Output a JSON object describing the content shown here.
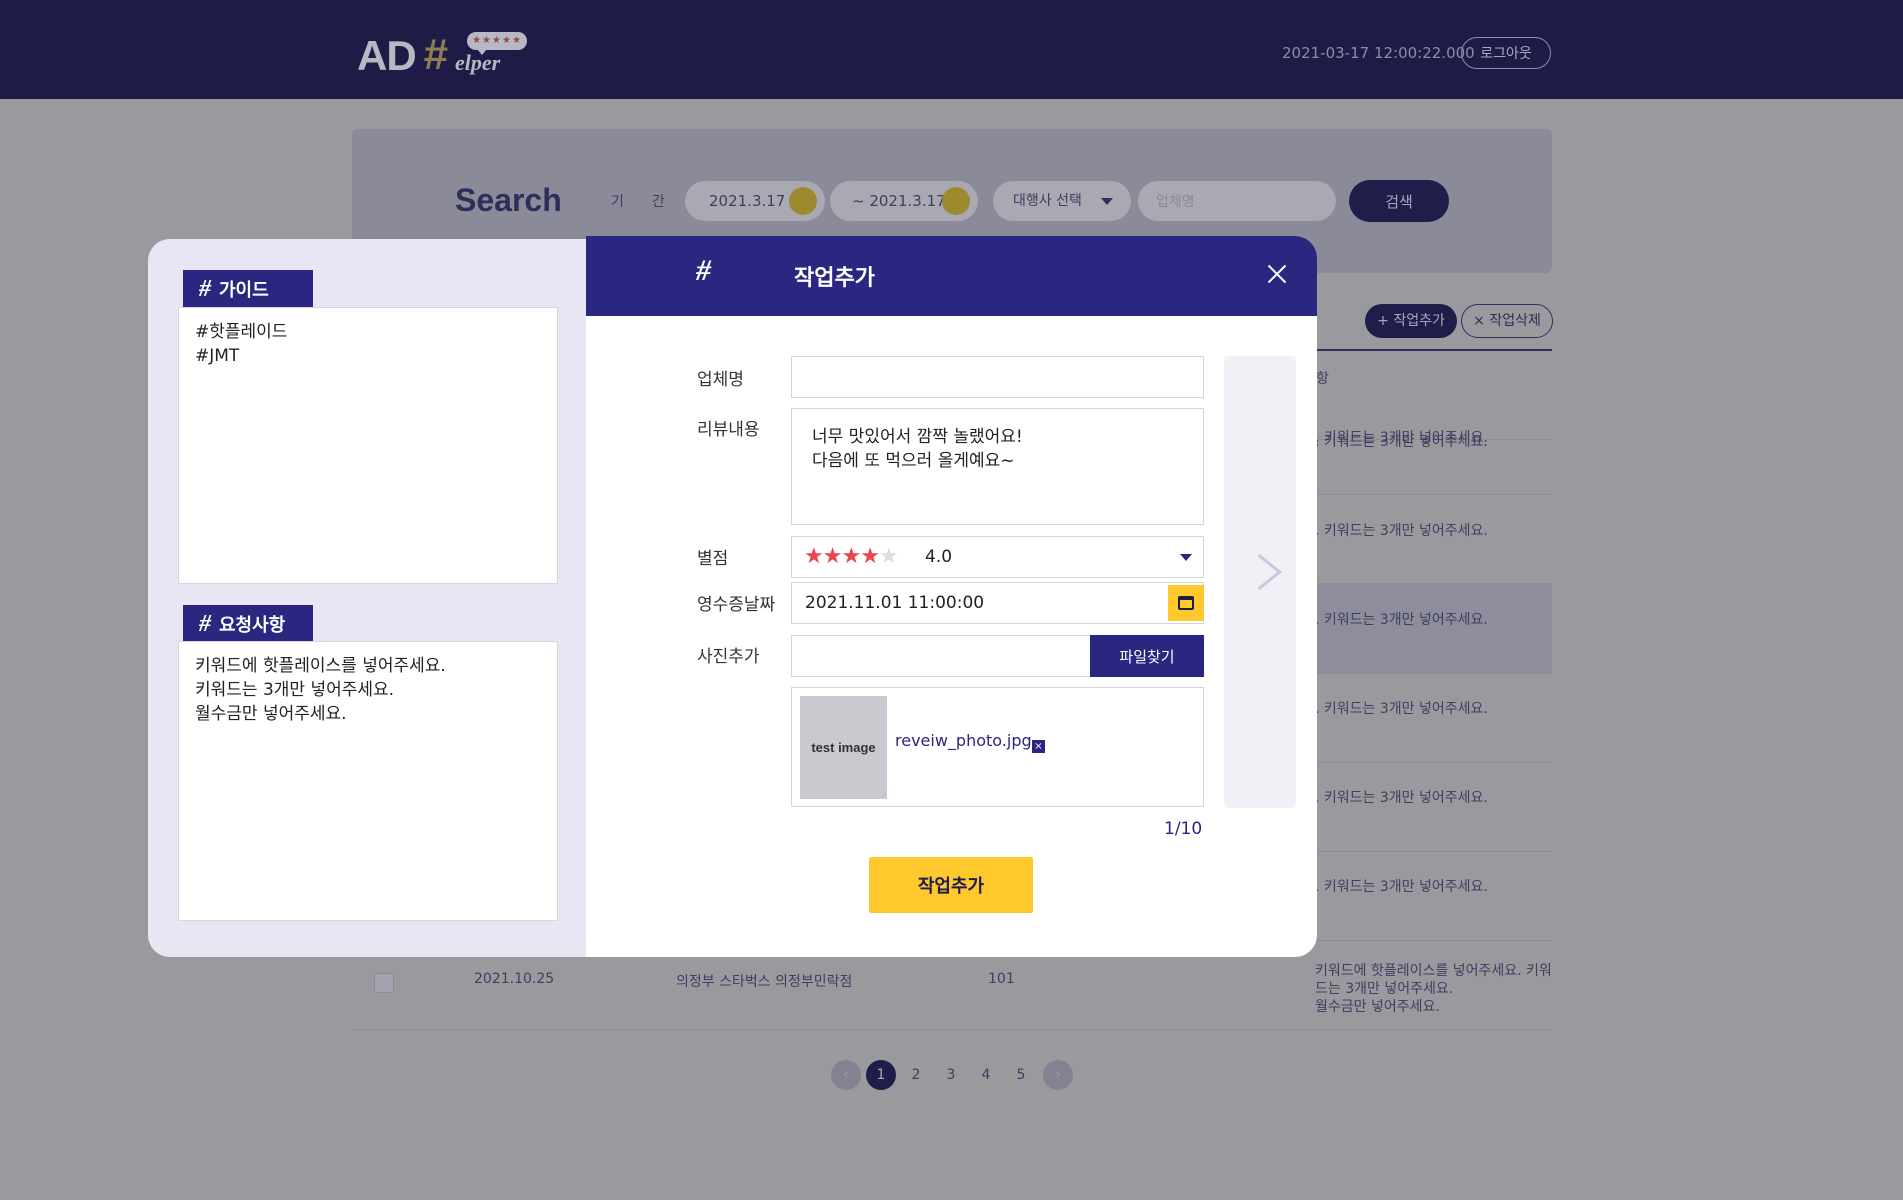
{
  "header": {
    "logo_ad": "AD",
    "logo_hash": "#",
    "logo_elper": "elper",
    "logo_stars": "★★★★★",
    "datetime": "2021-03-17 12:00:22.000",
    "logout_label": "로그아웃"
  },
  "search": {
    "title": "Search",
    "period_label": "기간",
    "date_from": "2021.3.17",
    "date_to": "~ 2021.3.17",
    "agency_placeholder": "대행사 선택",
    "company_placeholder": "업체명",
    "search_label": "검색"
  },
  "toolbar": {
    "add_label": "+ 작업추가",
    "delete_label": "× 작업삭제"
  },
  "table": {
    "partial_header": "항",
    "rows": [
      {
        "request": ". 키워드는 3개만 넣어주세요."
      },
      {
        "request": ". 키워드는 3개만 넣어주세요."
      },
      {
        "request": ". 키워드는 3개만 넣어주세요."
      },
      {
        "request": ". 키워드는 3개만 넣어주세요."
      },
      {
        "request": ". 키워드는 3개만 넣어주세요."
      },
      {
        "request": ". 키워드는 3개만 넣어주세요."
      }
    ],
    "last_row": {
      "date": "2021.10.25",
      "store": "의정부 스타벅스 의정부민락점",
      "number": "101",
      "request_line1": "키워드에 핫플레이스를 넣어주세요. 키워드는 3개만 넣어주세요.",
      "request_line2": "월수금만 넣어주세요."
    }
  },
  "pagination": {
    "pages": [
      "1",
      "2",
      "3",
      "4",
      "5"
    ],
    "prev": "‹",
    "next": "›"
  },
  "side_panel": {
    "guide_title": "가이드",
    "guide_text": "#핫플레이드\n#JMT",
    "request_title": "요청사항",
    "request_text": "키워드에 핫플레이스를 넣어주세요.\n키워드는 3개만 넣어주세요.\n월수금만 넣어주세요.",
    "hash": "#"
  },
  "modal": {
    "hash": "#",
    "title": "작업추가",
    "company_label": "업체명",
    "company_value": "",
    "review_label": "리뷰내용",
    "review_text": "너무 맛있어서 깜짝 놀랬어요!\n다음에 또 먹으러 올게예요~",
    "rating_label": "별점",
    "rating_value": "4.0",
    "rating": 4,
    "receipt_date_label": "영수증날짜",
    "receipt_date_value": "2021.11.01 11:00:00",
    "photo_label": "사진추가",
    "file_button": "파일찾기",
    "thumb_text": "test image",
    "file_name": "reveiw_photo.jpg",
    "remove_icon": "×",
    "counter": "1/10",
    "submit_label": "작업추가"
  },
  "colors": {
    "navy": "#2b2680",
    "header_bg": "#1e1c47",
    "accent_yellow": "#ffc82c",
    "star_red": "#e8474f"
  }
}
